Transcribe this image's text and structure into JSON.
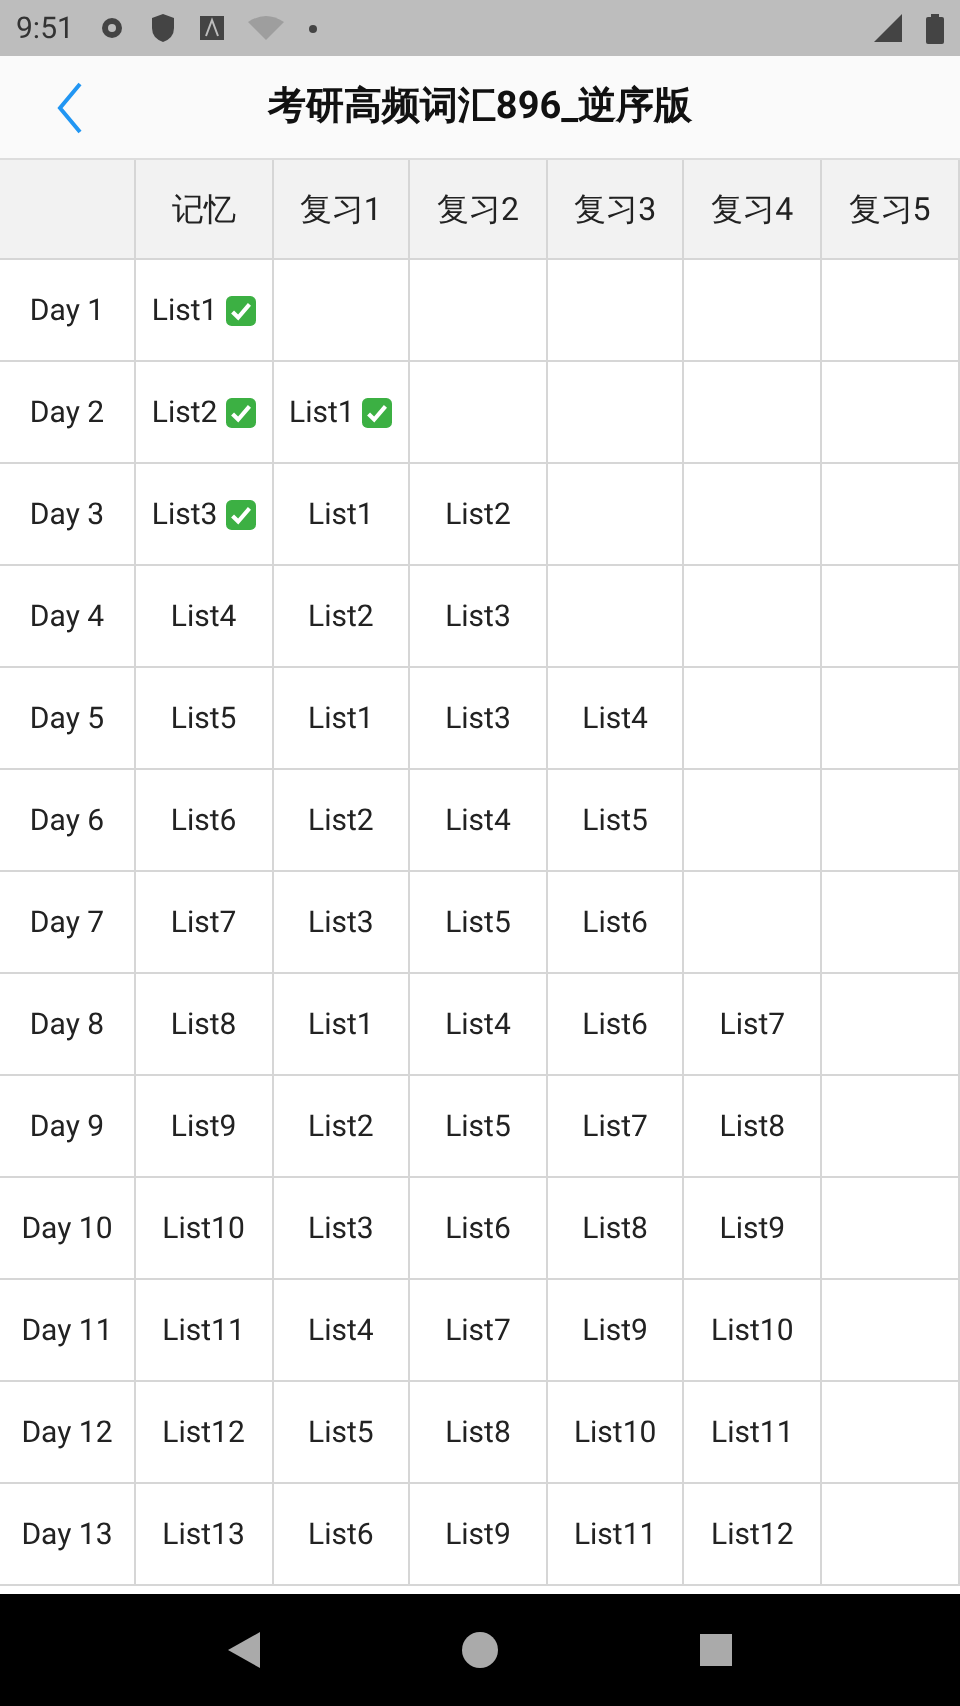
{
  "status_bar": {
    "time": "9:51"
  },
  "title": "考研高频词汇896_逆序版",
  "table": {
    "columns": [
      "记忆",
      "复习1",
      "复习2",
      "复习3",
      "复习4",
      "复习5"
    ],
    "rows": [
      {
        "day": "Day 1",
        "cells": [
          {
            "text": "List1",
            "done": true
          }
        ]
      },
      {
        "day": "Day 2",
        "cells": [
          {
            "text": "List2",
            "done": true
          },
          {
            "text": "List1",
            "done": true
          }
        ]
      },
      {
        "day": "Day 3",
        "cells": [
          {
            "text": "List3",
            "done": true
          },
          {
            "text": "List1",
            "done": false
          },
          {
            "text": "List2",
            "done": false
          }
        ]
      },
      {
        "day": "Day 4",
        "cells": [
          {
            "text": "List4",
            "done": false
          },
          {
            "text": "List2",
            "done": false
          },
          {
            "text": "List3",
            "done": false
          }
        ]
      },
      {
        "day": "Day 5",
        "cells": [
          {
            "text": "List5",
            "done": false
          },
          {
            "text": "List1",
            "done": false
          },
          {
            "text": "List3",
            "done": false
          },
          {
            "text": "List4",
            "done": false
          }
        ]
      },
      {
        "day": "Day 6",
        "cells": [
          {
            "text": "List6",
            "done": false
          },
          {
            "text": "List2",
            "done": false
          },
          {
            "text": "List4",
            "done": false
          },
          {
            "text": "List5",
            "done": false
          }
        ]
      },
      {
        "day": "Day 7",
        "cells": [
          {
            "text": "List7",
            "done": false
          },
          {
            "text": "List3",
            "done": false
          },
          {
            "text": "List5",
            "done": false
          },
          {
            "text": "List6",
            "done": false
          }
        ]
      },
      {
        "day": "Day 8",
        "cells": [
          {
            "text": "List8",
            "done": false
          },
          {
            "text": "List1",
            "done": false
          },
          {
            "text": "List4",
            "done": false
          },
          {
            "text": "List6",
            "done": false
          },
          {
            "text": "List7",
            "done": false
          }
        ]
      },
      {
        "day": "Day 9",
        "cells": [
          {
            "text": "List9",
            "done": false
          },
          {
            "text": "List2",
            "done": false
          },
          {
            "text": "List5",
            "done": false
          },
          {
            "text": "List7",
            "done": false
          },
          {
            "text": "List8",
            "done": false
          }
        ]
      },
      {
        "day": "Day 10",
        "cells": [
          {
            "text": "List10",
            "done": false
          },
          {
            "text": "List3",
            "done": false
          },
          {
            "text": "List6",
            "done": false
          },
          {
            "text": "List8",
            "done": false
          },
          {
            "text": "List9",
            "done": false
          }
        ]
      },
      {
        "day": "Day 11",
        "cells": [
          {
            "text": "List11",
            "done": false
          },
          {
            "text": "List4",
            "done": false
          },
          {
            "text": "List7",
            "done": false
          },
          {
            "text": "List9",
            "done": false
          },
          {
            "text": "List10",
            "done": false
          }
        ]
      },
      {
        "day": "Day 12",
        "cells": [
          {
            "text": "List12",
            "done": false
          },
          {
            "text": "List5",
            "done": false
          },
          {
            "text": "List8",
            "done": false
          },
          {
            "text": "List10",
            "done": false
          },
          {
            "text": "List11",
            "done": false
          }
        ]
      },
      {
        "day": "Day 13",
        "cells": [
          {
            "text": "List13",
            "done": false
          },
          {
            "text": "List6",
            "done": false
          },
          {
            "text": "List9",
            "done": false
          },
          {
            "text": "List11",
            "done": false
          },
          {
            "text": "List12",
            "done": false
          }
        ]
      }
    ]
  }
}
